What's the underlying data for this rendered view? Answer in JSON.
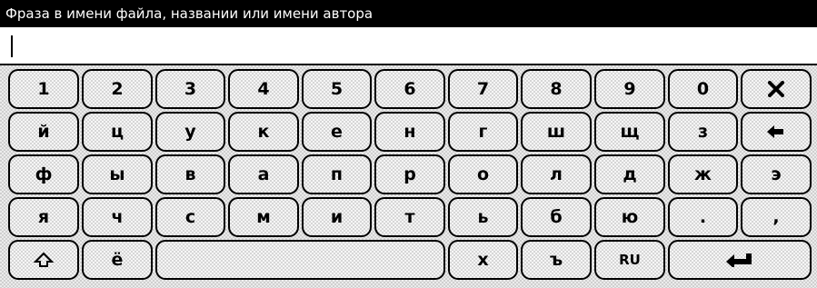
{
  "header": {
    "title": "Фраза в имени файла, названии или имени автора"
  },
  "search": {
    "value": ""
  },
  "keyboard": {
    "language_label": "RU",
    "rows": [
      [
        "1",
        "2",
        "3",
        "4",
        "5",
        "6",
        "7",
        "8",
        "9",
        "0"
      ],
      [
        "й",
        "ц",
        "у",
        "к",
        "е",
        "н",
        "г",
        "ш",
        "щ",
        "з"
      ],
      [
        "ф",
        "ы",
        "в",
        "а",
        "п",
        "р",
        "о",
        "л",
        "д",
        "ж",
        "э"
      ],
      [
        "я",
        "ч",
        "с",
        "м",
        "и",
        "т",
        "ь",
        "б",
        "ю",
        ".",
        ","
      ],
      [
        "ё",
        "х",
        "ъ"
      ]
    ],
    "icons": {
      "clear": "close-icon",
      "backspace": "backspace-arrow-icon",
      "shift": "shift-arrow-icon",
      "enter": "enter-arrow-icon"
    }
  }
}
